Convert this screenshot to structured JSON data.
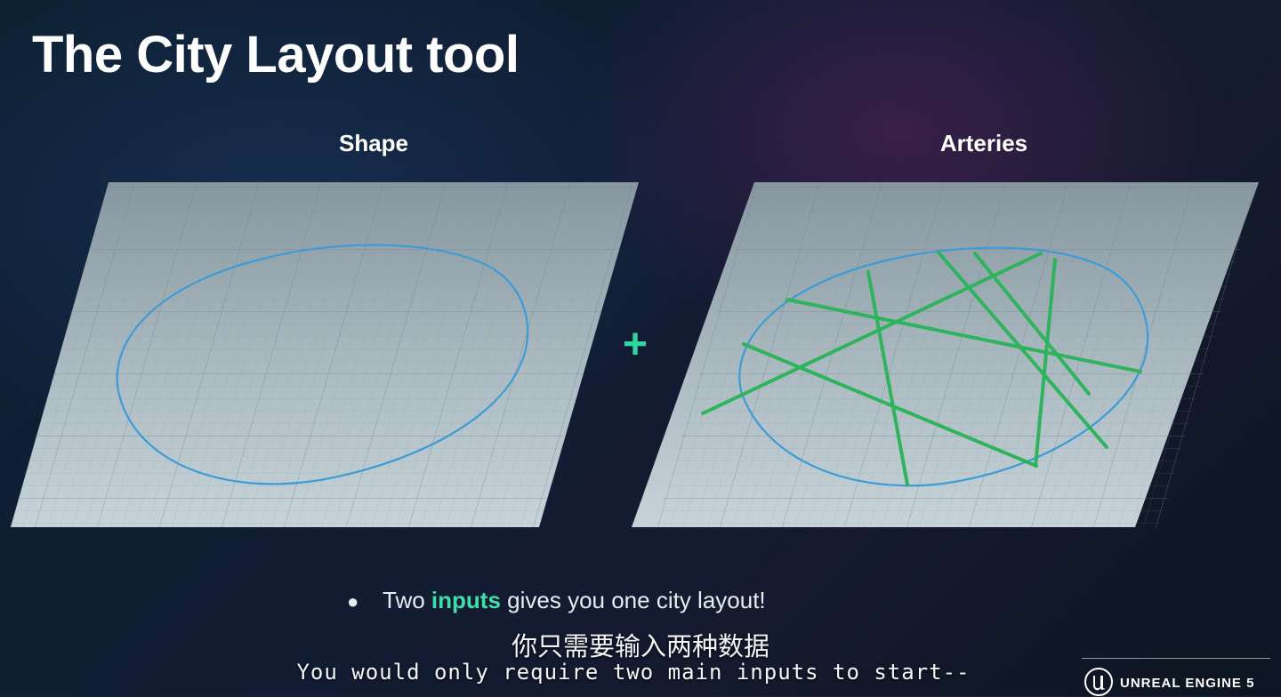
{
  "slide": {
    "title": "The City Layout tool",
    "panels": [
      {
        "label": "Shape",
        "content": "outline"
      },
      {
        "label": "Arteries",
        "content": "outline-with-roads"
      }
    ],
    "operator": "+",
    "bullet": {
      "before": "Two ",
      "highlight": "inputs",
      "after": " gives you one city layout!"
    }
  },
  "subtitles": {
    "chinese": "你只需要输入两种数据",
    "english": "You would only require two main inputs to start--"
  },
  "branding": {
    "logo_icon": "unreal-engine-logo-icon",
    "text": "UNREAL ENGINE 5"
  },
  "colors": {
    "accent": "#3fe0a8",
    "outline_stroke": "#3d9bd6",
    "road_stroke": "#2fb35c"
  }
}
